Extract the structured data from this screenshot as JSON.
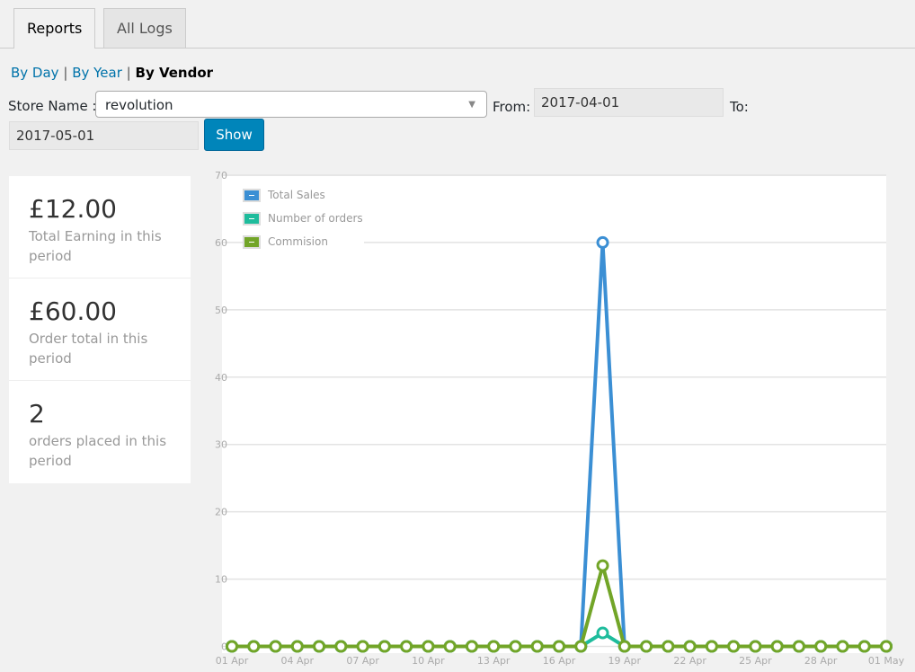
{
  "tabs": [
    {
      "label": "Reports",
      "active": true
    },
    {
      "label": "All Logs",
      "active": false
    }
  ],
  "subnav": {
    "by_day": "By Day",
    "by_year": "By Year",
    "by_vendor": "By Vendor",
    "sep": "|"
  },
  "filters": {
    "store_label": "Store Name :",
    "store_value": "revolution",
    "from_label": "From:",
    "from_value": "2017-04-01",
    "to_label": "To:",
    "to_value": "2017-05-01",
    "show_label": "Show"
  },
  "stats": [
    {
      "value": "£12.00",
      "label": "Total Earning in this period"
    },
    {
      "value": "£60.00",
      "label": "Order total in this period"
    },
    {
      "value": "2",
      "label": "orders placed in this period"
    }
  ],
  "chart_data": {
    "type": "line",
    "ylim": [
      0,
      70
    ],
    "yticks": [
      0,
      10,
      20,
      30,
      40,
      50,
      60,
      70
    ],
    "grid": true,
    "legend": "top-left",
    "x": [
      "01 Apr",
      "02 Apr",
      "03 Apr",
      "04 Apr",
      "05 Apr",
      "06 Apr",
      "07 Apr",
      "08 Apr",
      "09 Apr",
      "10 Apr",
      "11 Apr",
      "12 Apr",
      "13 Apr",
      "14 Apr",
      "15 Apr",
      "16 Apr",
      "17 Apr",
      "18 Apr",
      "19 Apr",
      "20 Apr",
      "21 Apr",
      "22 Apr",
      "23 Apr",
      "24 Apr",
      "25 Apr",
      "26 Apr",
      "27 Apr",
      "28 Apr",
      "29 Apr",
      "30 Apr",
      "01 May"
    ],
    "xtick_labels": [
      "01 Apr",
      "04 Apr",
      "07 Apr",
      "10 Apr",
      "13 Apr",
      "16 Apr",
      "19 Apr",
      "22 Apr",
      "25 Apr",
      "28 Apr",
      "01 May"
    ],
    "series": [
      {
        "name": "Total Sales",
        "color": "#3b8fd4",
        "values": [
          0,
          0,
          0,
          0,
          0,
          0,
          0,
          0,
          0,
          0,
          0,
          0,
          0,
          0,
          0,
          0,
          0,
          60,
          0,
          0,
          0,
          0,
          0,
          0,
          0,
          0,
          0,
          0,
          0,
          0,
          0
        ]
      },
      {
        "name": "Number of orders",
        "color": "#1ebc9c",
        "values": [
          0,
          0,
          0,
          0,
          0,
          0,
          0,
          0,
          0,
          0,
          0,
          0,
          0,
          0,
          0,
          0,
          0,
          2,
          0,
          0,
          0,
          0,
          0,
          0,
          0,
          0,
          0,
          0,
          0,
          0,
          0
        ]
      },
      {
        "name": "Commision",
        "color": "#72a528",
        "values": [
          0,
          0,
          0,
          0,
          0,
          0,
          0,
          0,
          0,
          0,
          0,
          0,
          0,
          0,
          0,
          0,
          0,
          12,
          0,
          0,
          0,
          0,
          0,
          0,
          0,
          0,
          0,
          0,
          0,
          0,
          0
        ]
      }
    ]
  }
}
